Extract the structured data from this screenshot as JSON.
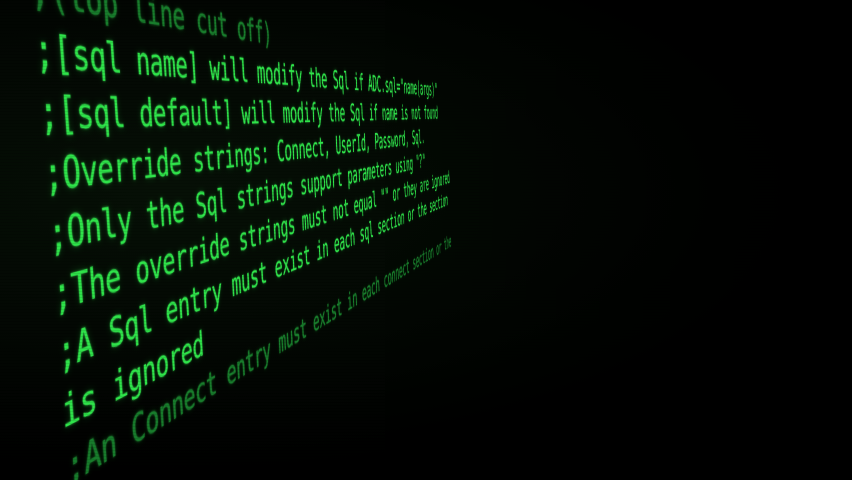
{
  "terminal": {
    "lines": [
      ";(top line cut off)",
      ";[sql name] will modify the Sql if ADC.sql=\"name(args)\"",
      ";[sql default] will modify the Sql if name is not found",
      ";Override strings: Connect, UserId, Password, Sql.",
      ";Only the Sql strings support parameters using \"?\"",
      ";The override strings must not equal \"\" or they are ignored",
      ";A Sql entry must exist in each sql section or the section",
      "is ignored",
      ";An Connect entry must exist in each connect section or the"
    ]
  },
  "colors": {
    "text": "#2fe34a",
    "background": "#000000"
  }
}
